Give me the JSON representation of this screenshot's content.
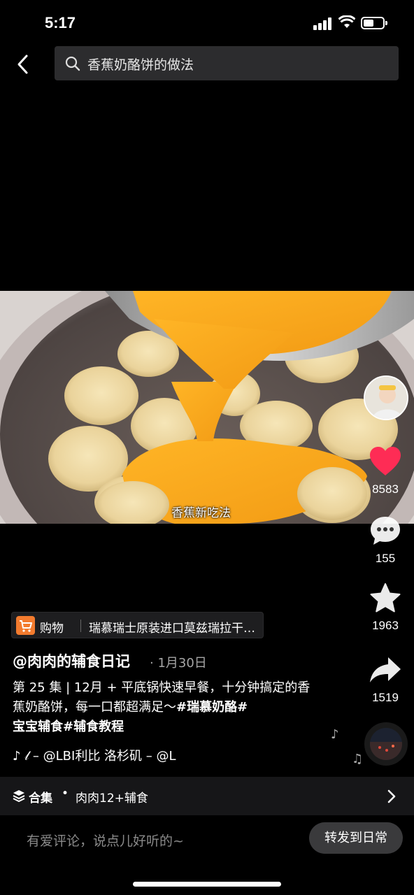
{
  "status_bar": {
    "time": "5:17"
  },
  "search": {
    "query": "香蕉奶酪饼的做法"
  },
  "video": {
    "caption": "香蕉新吃法"
  },
  "actions": {
    "likes": "8583",
    "comments": "155",
    "favorites": "1963",
    "shares": "1519"
  },
  "product": {
    "type": "购物",
    "name": "瑞慕瑞士原装进口莫兹瑞拉干…"
  },
  "post": {
    "author": "@肉肉的辅食日记",
    "date": "· 1月30日",
    "desc_text": "第 25 集 | 12月 + 平底锅快速早餐，十分钟搞定的香蕉奶酪饼，每一口都超满足～",
    "tag1": "#瑞慕奶酪#",
    "tag2": "宝宝辅食#辅食教程",
    "music": "♪ 𝓁 – @LBI利比    洛杉矶 – @L"
  },
  "collection": {
    "label": "合集",
    "dot": "•",
    "name": "肉肉12+辅食"
  },
  "comment": {
    "placeholder": "有爱评论，说点儿好听的~",
    "repost_label": "转发到日常"
  },
  "colors": {
    "like": "#fe2c55",
    "shop": "#f37b2e",
    "egg": "#f6a31b"
  }
}
